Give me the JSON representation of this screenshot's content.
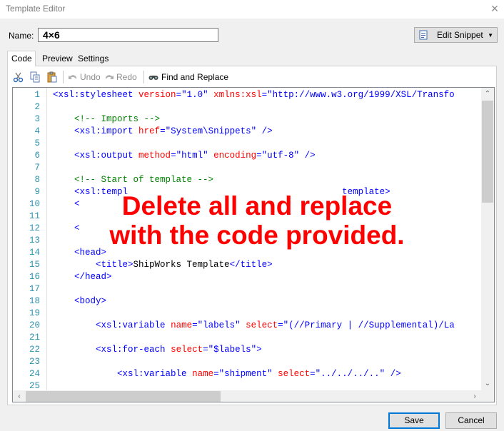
{
  "window": {
    "title": "Template Editor",
    "close_glyph": "×"
  },
  "name_row": {
    "label": "Name:",
    "value": "4×6"
  },
  "snippet_button": {
    "label": "Edit Snippet",
    "icon": "snippet-icon"
  },
  "tabs": [
    {
      "label": "Code",
      "active": true
    },
    {
      "label": "Preview",
      "active": false
    },
    {
      "label": "Settings",
      "active": false
    }
  ],
  "toolbar": {
    "cut_icon": "scissors-icon",
    "copy_icon": "copy-icon",
    "paste_icon": "paste-icon",
    "undo_label": "Undo",
    "redo_label": "Redo",
    "find_replace_label": "Find and Replace"
  },
  "editor": {
    "line_numbers": [
      "1",
      "2",
      "3",
      "4",
      "5",
      "6",
      "7",
      "8",
      "9",
      "10",
      "11",
      "12",
      "13",
      "14",
      "15",
      "16",
      "17",
      "18",
      "19",
      "20",
      "21",
      "22",
      "23",
      "24",
      "25"
    ]
  },
  "annotation": {
    "line1": "Delete all and replace",
    "line2": "with the code provided."
  },
  "buttons": {
    "save": "Save",
    "cancel": "Cancel"
  }
}
